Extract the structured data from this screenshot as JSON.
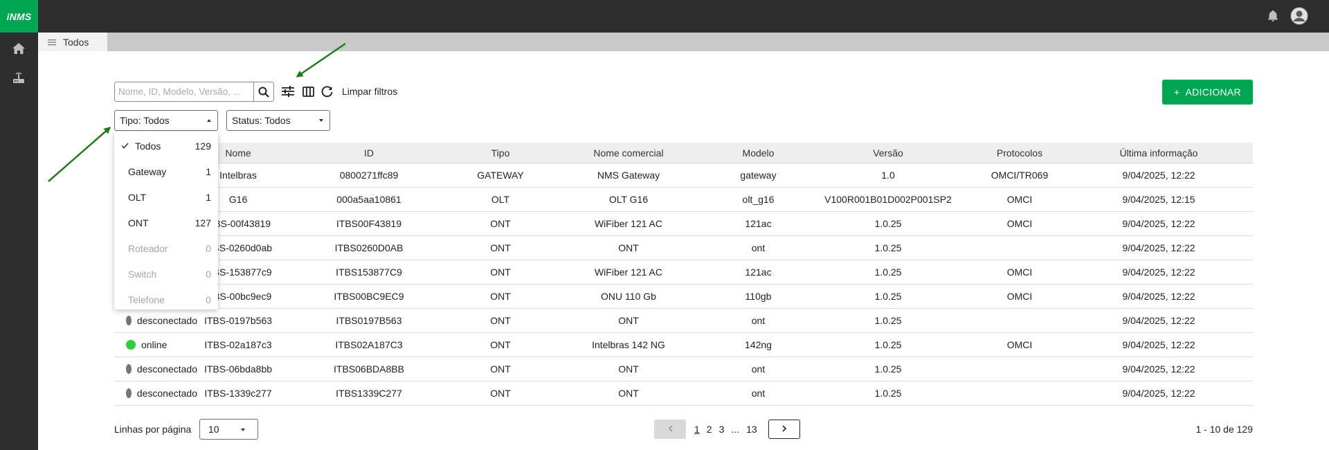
{
  "app": {
    "logo": "iNMS"
  },
  "tab": {
    "label": "Todos"
  },
  "toolbar": {
    "search_placeholder": "Nome, ID, Modelo, Versão, ...",
    "clear_filters": "Limpar filtros",
    "add_button": "ADICIONAR",
    "add_symbol": "+"
  },
  "filters": {
    "type": "Tipo: Todos",
    "status": "Status: Todos"
  },
  "type_dropdown": {
    "items": [
      {
        "label": "Todos",
        "count": "129",
        "selected": true,
        "disabled": false
      },
      {
        "label": "Gateway",
        "count": "1",
        "selected": false,
        "disabled": false
      },
      {
        "label": "OLT",
        "count": "1",
        "selected": false,
        "disabled": false
      },
      {
        "label": "ONT",
        "count": "127",
        "selected": false,
        "disabled": false
      },
      {
        "label": "Roteador",
        "count": "0",
        "selected": false,
        "disabled": true
      },
      {
        "label": "Switch",
        "count": "0",
        "selected": false,
        "disabled": true
      },
      {
        "label": "Telefone",
        "count": "0",
        "selected": false,
        "disabled": true
      }
    ]
  },
  "table": {
    "columns": [
      "Nome",
      "ID",
      "Tipo",
      "Nome comercial",
      "Modelo",
      "Versão",
      "Protocolos",
      "Última informação"
    ],
    "rows": [
      {
        "status": "",
        "status_color": "",
        "nome": "Intelbras",
        "id": "0800271ffc89",
        "tipo": "GATEWAY",
        "comercial": "NMS Gateway",
        "modelo": "gateway",
        "versao": "1.0",
        "protocolos": "OMCI/TR069",
        "ultima": "9/04/2025, 12:22"
      },
      {
        "status": "",
        "status_color": "",
        "nome": "G16",
        "id": "000a5aa10861",
        "tipo": "OLT",
        "comercial": "OLT G16",
        "modelo": "olt_g16",
        "versao": "V100R001B01D002P001SP2",
        "protocolos": "OMCI",
        "ultima": "9/04/2025, 12:15"
      },
      {
        "status": "",
        "status_color": "",
        "nome": "ITBS-00f43819",
        "id": "ITBS00F43819",
        "tipo": "ONT",
        "comercial": "WiFiber 121 AC",
        "modelo": "121ac",
        "versao": "1.0.25",
        "protocolos": "OMCI",
        "ultima": "9/04/2025, 12:22"
      },
      {
        "status": "",
        "status_color": "",
        "nome": "ITBS-0260d0ab",
        "id": "ITBS0260D0AB",
        "tipo": "ONT",
        "comercial": "ONT",
        "modelo": "ont",
        "versao": "1.0.25",
        "protocolos": "",
        "ultima": "9/04/2025, 12:22"
      },
      {
        "status": "",
        "status_color": "",
        "nome": "ITBS-153877c9",
        "id": "ITBS153877C9",
        "tipo": "ONT",
        "comercial": "WiFiber 121 AC",
        "modelo": "121ac",
        "versao": "1.0.25",
        "protocolos": "OMCI",
        "ultima": "9/04/2025, 12:22"
      },
      {
        "status": "",
        "status_color": "",
        "nome": "ITBS-00bc9ec9",
        "id": "ITBS00BC9EC9",
        "tipo": "ONT",
        "comercial": "ONU 110 Gb",
        "modelo": "110gb",
        "versao": "1.0.25",
        "protocolos": "OMCI",
        "ultima": "9/04/2025, 12:22"
      },
      {
        "status": "desconectado",
        "status_color": "#757575",
        "nome": "ITBS-0197b563",
        "id": "ITBS0197B563",
        "tipo": "ONT",
        "comercial": "ONT",
        "modelo": "ont",
        "versao": "1.0.25",
        "protocolos": "",
        "ultima": "9/04/2025, 12:22"
      },
      {
        "status": "online",
        "status_color": "#2ecc40",
        "nome": "ITBS-02a187c3",
        "id": "ITBS02A187C3",
        "tipo": "ONT",
        "comercial": "Intelbras 142 NG",
        "modelo": "142ng",
        "versao": "1.0.25",
        "protocolos": "OMCI",
        "ultima": "9/04/2025, 12:22"
      },
      {
        "status": "desconectado",
        "status_color": "#757575",
        "nome": "ITBS-06bda8bb",
        "id": "ITBS06BDA8BB",
        "tipo": "ONT",
        "comercial": "ONT",
        "modelo": "ont",
        "versao": "1.0.25",
        "protocolos": "",
        "ultima": "9/04/2025, 12:22"
      },
      {
        "status": "desconectado",
        "status_color": "#757575",
        "nome": "ITBS-1339c277",
        "id": "ITBS1339C277",
        "tipo": "ONT",
        "comercial": "ONT",
        "modelo": "ont",
        "versao": "1.0.25",
        "protocolos": "",
        "ultima": "9/04/2025, 12:22"
      }
    ]
  },
  "footer": {
    "rows_label": "Linhas por página",
    "rows_value": "10",
    "pages": [
      "1",
      "2",
      "3",
      "...",
      "13"
    ],
    "current_page": "1",
    "range": "1 - 10 de 129"
  },
  "colors": {
    "brand": "#00a651",
    "topbar": "#2d2d2d",
    "annotation_arrow": "#1e7a1e"
  },
  "icons": [
    "bell-icon",
    "avatar-icon",
    "home-icon",
    "router-icon",
    "menu-icon",
    "search-icon",
    "filter-sliders-icon",
    "columns-icon",
    "refresh-icon",
    "chevron-left-icon",
    "chevron-right-icon",
    "check-icon"
  ]
}
